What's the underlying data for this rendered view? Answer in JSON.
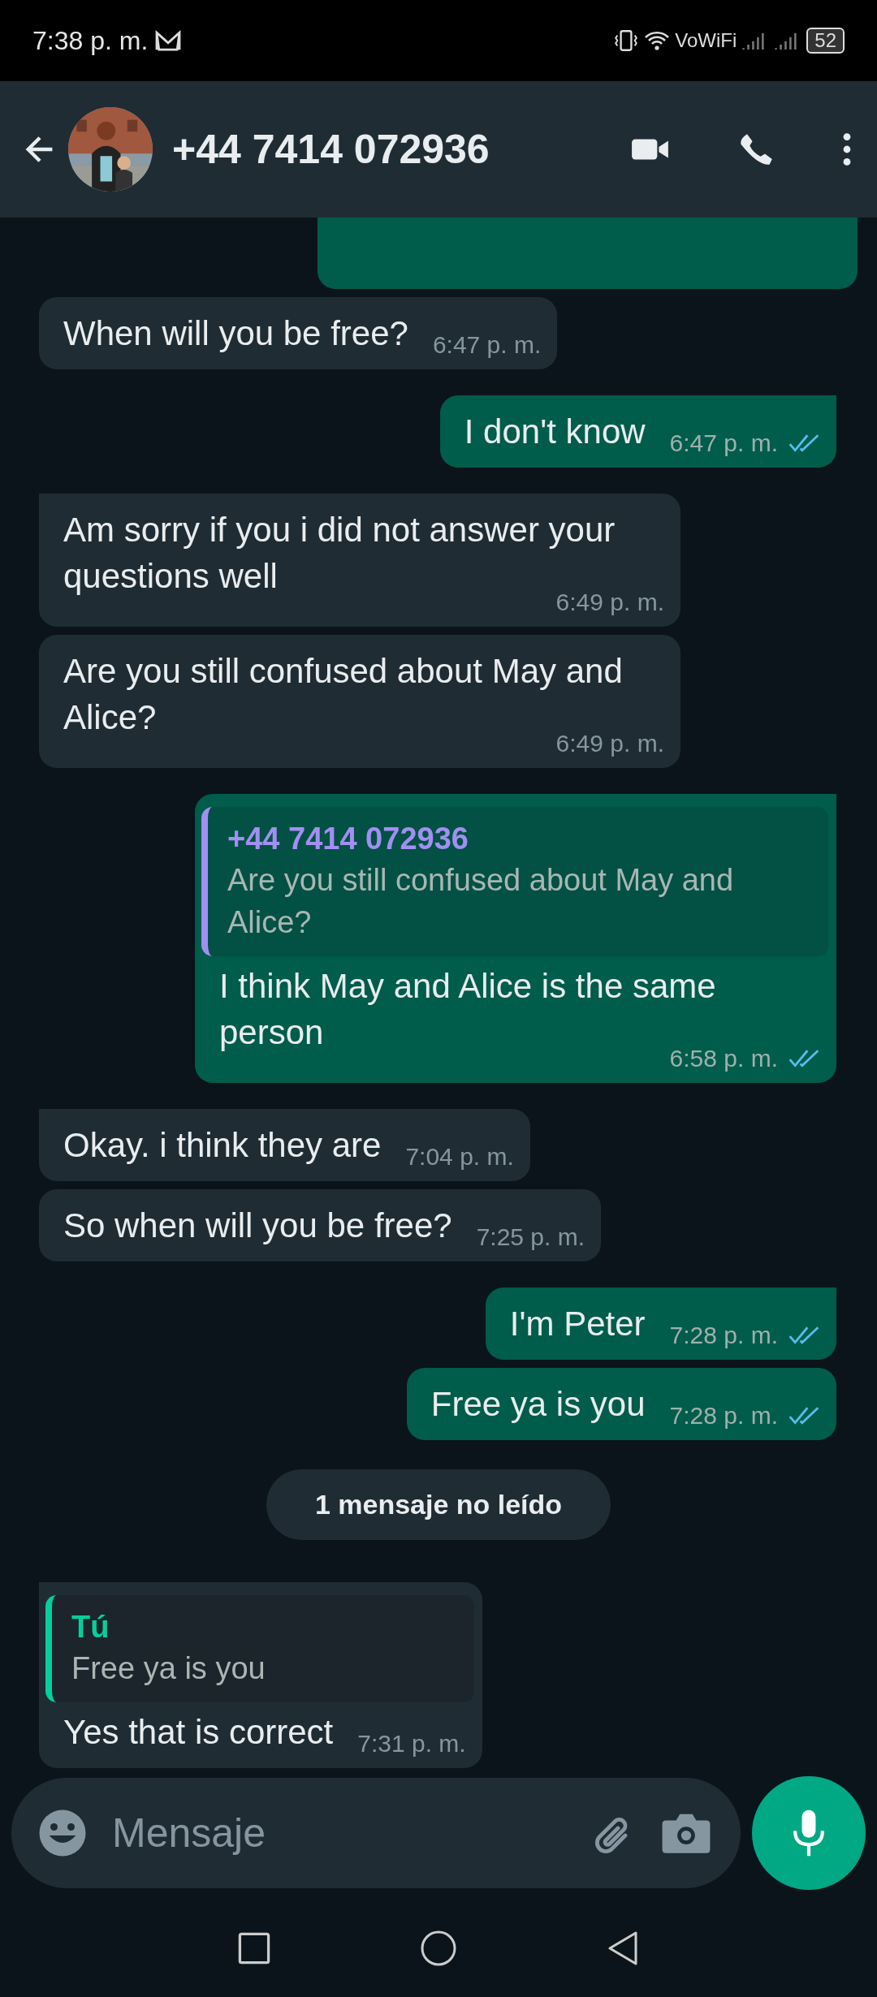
{
  "status_bar": {
    "time": "7:38 p. m.",
    "network_label": "VoWiFi",
    "battery": "52"
  },
  "header": {
    "title": "+44 7414 072936"
  },
  "messages": [
    {
      "kind": "clipped"
    },
    {
      "kind": "in",
      "tail": false,
      "text": "When will you be free?",
      "time": "6:47 p. m."
    },
    {
      "kind": "out",
      "tail": true,
      "text": "I don't know",
      "time": "6:47 p. m.",
      "read": true
    },
    {
      "kind": "in",
      "tail": true,
      "text": "Am sorry if you i did not answer your questions well",
      "time": "6:49 p. m."
    },
    {
      "kind": "in",
      "tail": false,
      "text": "Are you still confused about May and Alice?",
      "time": "6:49 p. m."
    },
    {
      "kind": "out",
      "tail": true,
      "quote": {
        "author": "+44 7414 072936",
        "text": "Are you still confused about May and Alice?",
        "color": "#a18ff2"
      },
      "text": "I think May and Alice is the same person",
      "time": "6:58 p. m.",
      "read": true
    },
    {
      "kind": "in",
      "tail": true,
      "text": "Okay. i think they are",
      "time": "7:04 p. m."
    },
    {
      "kind": "in",
      "tail": false,
      "text": "So when will you be free?",
      "time": "7:25 p. m."
    },
    {
      "kind": "out",
      "tail": true,
      "text": "I'm Peter",
      "time": "7:28 p. m.",
      "read": true
    },
    {
      "kind": "out",
      "tail": false,
      "text": "Free ya is you",
      "time": "7:28 p. m.",
      "read": true
    },
    {
      "kind": "divider",
      "text": "1 mensaje no leído"
    },
    {
      "kind": "in",
      "tail": true,
      "quote": {
        "author": "Tú",
        "text": "Free ya is you",
        "color": "#06cf9c"
      },
      "text": "Yes that is correct",
      "time": "7:31 p. m."
    }
  ],
  "composer": {
    "placeholder": "Mensaje"
  }
}
